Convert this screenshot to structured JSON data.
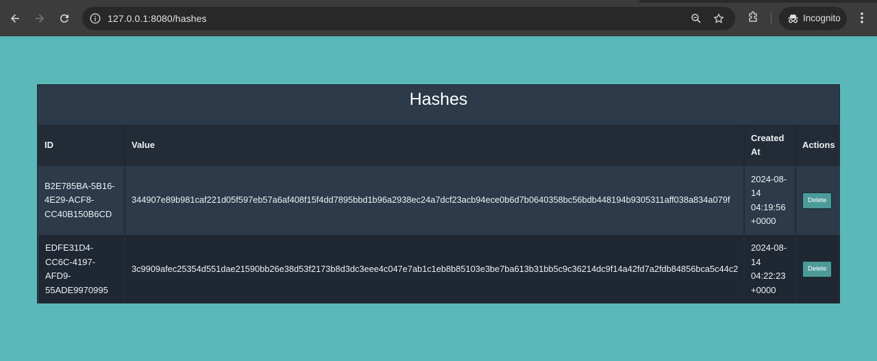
{
  "browser": {
    "url": "127.0.0.1:8080/hashes",
    "profile_label": "Incognito"
  },
  "page": {
    "title": "Hashes",
    "columns": {
      "id": "ID",
      "value": "Value",
      "created_at": "Created At",
      "actions": "Actions"
    },
    "rows": [
      {
        "id": "B2E785BA-5B16-4E29-ACF8-CC40B150B6CD",
        "value": "344907e89b981caf221d05f597eb57a6af408f15f4dd7895bbd1b96a2938ec24a7dcf23acb94ece0b6d7b0640358bc56bdb448194b9305311aff038a834a079f",
        "created_at": "2024-08-14 04:19:56 +0000",
        "action_label": "Delete"
      },
      {
        "id": "EDFE31D4-CC6C-4197-AFD9-55ADE9970995",
        "value": "3c9909afec25354d551dae21590bb26e38d53f2173b8d3dc3eee4c047e7ab1c1eb8b85103e3be7ba613b31bb5c9c36214dc9f14a42fd7a2fdb84856bca5c44c2",
        "created_at": "2024-08-14 04:22:23 +0000",
        "action_label": "Delete"
      }
    ]
  },
  "colors": {
    "page_background": "#5bb8b8",
    "panel_background": "#2c3a4a",
    "header_row_background": "#232b36",
    "alt_row_background": "#1f2733",
    "delete_button": "#4d9a9a"
  }
}
